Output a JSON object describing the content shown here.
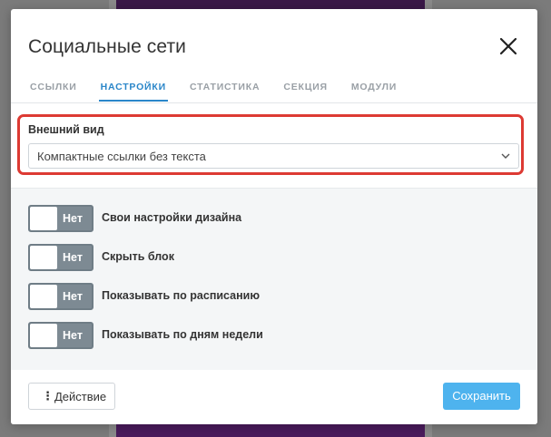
{
  "modal": {
    "title": "Социальные сети",
    "close_icon": "close-icon"
  },
  "tabs": [
    {
      "label": "ССЫЛКИ",
      "active": false
    },
    {
      "label": "НАСТРОЙКИ",
      "active": true
    },
    {
      "label": "СТАТИСТИКА",
      "active": false
    },
    {
      "label": "СЕКЦИЯ",
      "active": false
    },
    {
      "label": "МОДУЛИ",
      "active": false
    }
  ],
  "appearance": {
    "label": "Внешний вид",
    "selected": "Компактные ссылки без текста",
    "chevron_icon": "chevron-down-icon"
  },
  "toggles": [
    {
      "state": "Нет",
      "label": "Свои настройки дизайна"
    },
    {
      "state": "Нет",
      "label": "Скрыть блок"
    },
    {
      "state": "Нет",
      "label": "Показывать по расписанию"
    },
    {
      "state": "Нет",
      "label": "Показывать по дням недели"
    }
  ],
  "footer": {
    "action_icon": "more-vertical-icon",
    "action_label": "Действие",
    "save_label": "Сохранить"
  },
  "colors": {
    "accent": "#2a86c9",
    "save_button": "#4eb3ee",
    "highlight": "#dd3a33",
    "toggle_off": "#7d8a93"
  }
}
